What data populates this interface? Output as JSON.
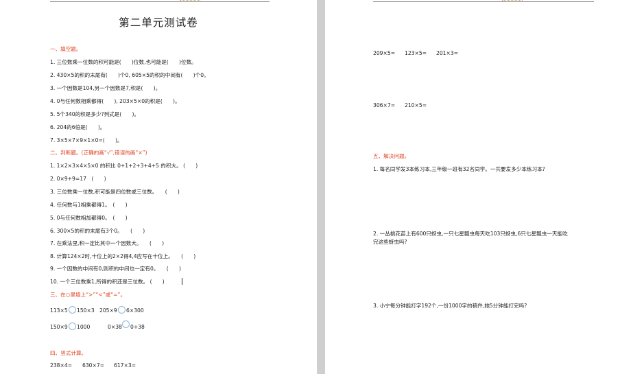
{
  "left_page": {
    "title": "第二单元测试卷",
    "section1": {
      "heading": "一、填空题。",
      "items": [
        "1. 三位数乘一位数的积可能是(　　)位数,也可能是(　　)位数。",
        "2. 430×5的积的末尾有(　　)个0, 605×5的积的中间有(　　)个0。",
        "3. 一个因数是104,另一个因数是7,积是(　　)。",
        "4. 0与任何数相乘都得(　　), 203×5×0的积是(　　)。",
        "5. 5个340的积是多少?列式是(　　)。",
        "6. 204的6倍是(　　)。",
        "7. 3×5×7×9×1×0=(　　)。"
      ]
    },
    "section2": {
      "heading": "二、判断题。(正确的画“√”,错误的画“×”)",
      "items": [
        "1. 1×2×3×4×5×0 的积比 0+1+2+3+4+5 的积大。 (　　)",
        "2. 0×9+9=17　(　　)",
        "3. 三位数乘一位数,积可能是四位数或三位数。　　(　　)",
        "4. 任何数与1相乘都得1。　(　　)",
        "5. 0与任何数相加都得0。　(　　)",
        "6. 300×5的积的末尾有3个0。　　(　　)",
        "7. 在乘法里,积一定比其中一个因数大。　　(　　)",
        "8. 计算124×2时,十位上的2×2得4,4应写在十位上。　　(　　)",
        "9. 一个因数的中间有0,则积的中间也一定有0。　　(　　)",
        "10. 一个三位数乘1,所得的积还是三位数。 (　　)"
      ]
    },
    "section3": {
      "heading": "三、在○里填上“>”“<”或“=”。",
      "rows": [
        [
          "113×5",
          "150×3",
          "205×9",
          "6×300"
        ],
        [
          "150×9",
          "1000",
          "0×38",
          "0+38"
        ]
      ]
    },
    "section4": {
      "heading": "四、竖式计算。",
      "items": [
        "238×4=",
        "630×7=",
        "617×3="
      ]
    }
  },
  "right_page": {
    "calc_row1": [
      "209×5=",
      "123×5=",
      "201×3="
    ],
    "calc_row2": [
      "306×7=",
      "210×5="
    ],
    "section5": {
      "heading": "五、解决问题。",
      "problems": [
        "1. 每名同学发3本练习本,三年级一班有32名同学。一共要发多少本练习本?",
        "2. 一丛桃花苗上有600只蚜虫,一只七星瓢虫每天吃103只蚜虫,6只七星瓢虫一天能吃",
        "完这些蚜虫吗?",
        "3. 小宁每分钟能打字192个,一份1000字的稿件,她5分钟能打完吗?"
      ]
    }
  },
  "colors": {
    "section_heading": "#e0401f",
    "body_text": "#222222",
    "circle_outline": "#8fb4d9"
  }
}
